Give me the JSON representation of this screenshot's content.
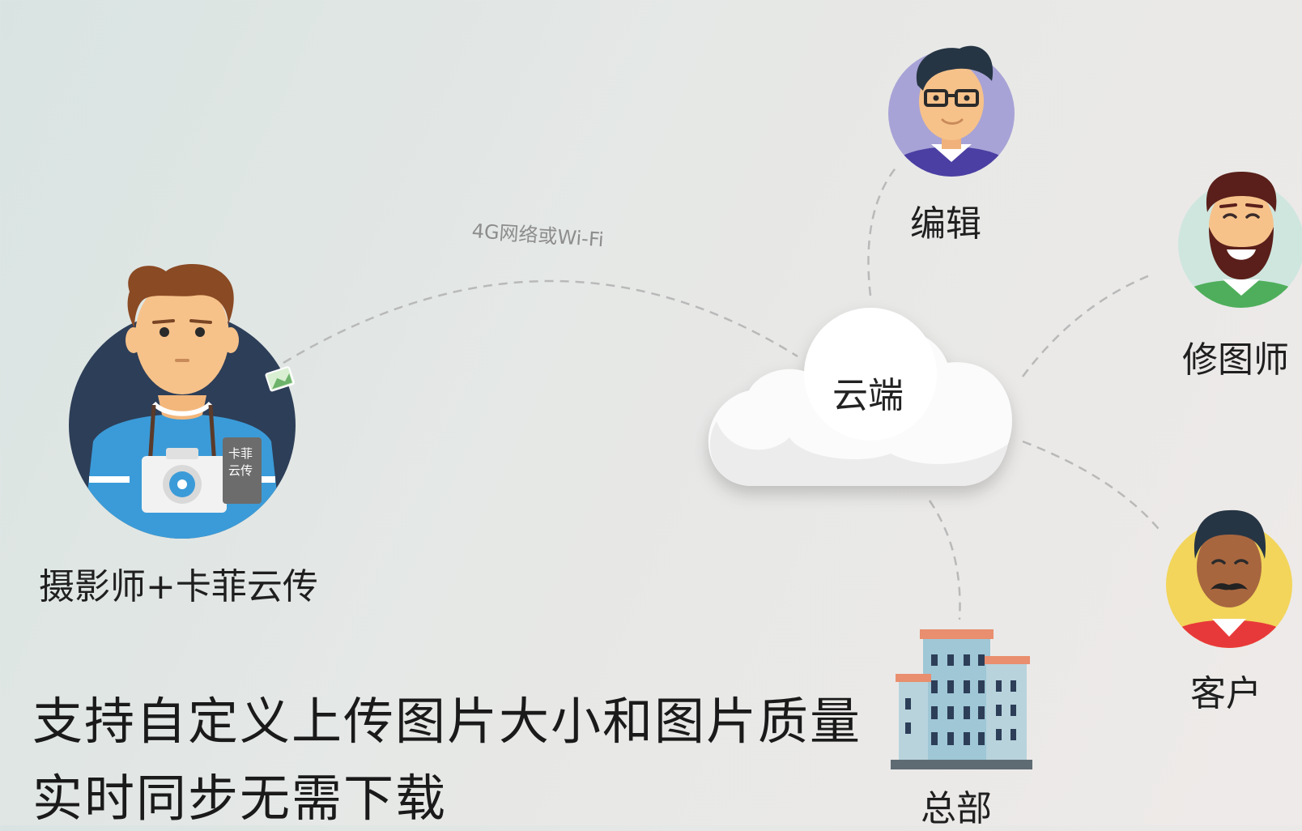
{
  "connection": {
    "label": "4G网络或Wi-Fi"
  },
  "cloud": {
    "label": "云端"
  },
  "nodes": {
    "photographer": {
      "label": "摄影师+卡菲云传",
      "device_label_line1": "卡菲",
      "device_label_line2": "云传"
    },
    "editor": {
      "label": "编辑"
    },
    "retoucher": {
      "label": "修图师"
    },
    "client": {
      "label": "客户"
    },
    "headquarters": {
      "label": "总部"
    }
  },
  "captions": {
    "line1": "支持自定义上传图片大小和图片质量",
    "line2": "实时同步无需下载"
  },
  "colors": {
    "photographer_circle": "#2d3e58",
    "editor_circle": "#a8a3d6",
    "retoucher_circle": "#cfe6df",
    "client_circle": "#f2d55a",
    "dashed_line": "#b9b9b9"
  }
}
